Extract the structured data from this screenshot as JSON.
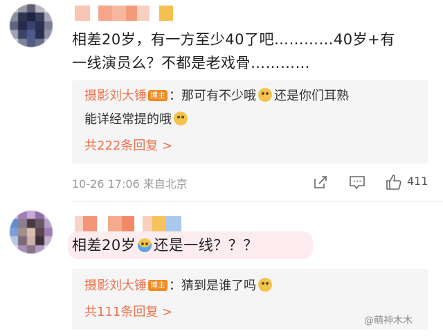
{
  "comments": [
    {
      "text_line1": "相差20岁，有一方至少40了吧…………40岁+有",
      "text_line2": "一线演员么？不都是老戏骨…………",
      "reply_author": "摄影刘大锤",
      "badge": "博主",
      "reply_line1": "：那可有不少哦",
      "reply_line1b": "还是你们耳熟",
      "reply_line2": "能详经常提的哦",
      "more_replies": "共222条回复 >",
      "time": "10-26 17:06  来自北京",
      "likes": "411"
    },
    {
      "text_a": "相差20岁",
      "text_b": "还是一线？？？",
      "reply_author": "摄影刘大锤",
      "badge": "博主",
      "reply_line1": "：猜到是谁了吗",
      "more_replies": "共111条回复 >"
    }
  ],
  "watermark": "@萌神木木",
  "icons": [
    "share-icon",
    "comment-icon",
    "like-icon",
    "doge-emoji",
    "facepalm-emoji"
  ]
}
